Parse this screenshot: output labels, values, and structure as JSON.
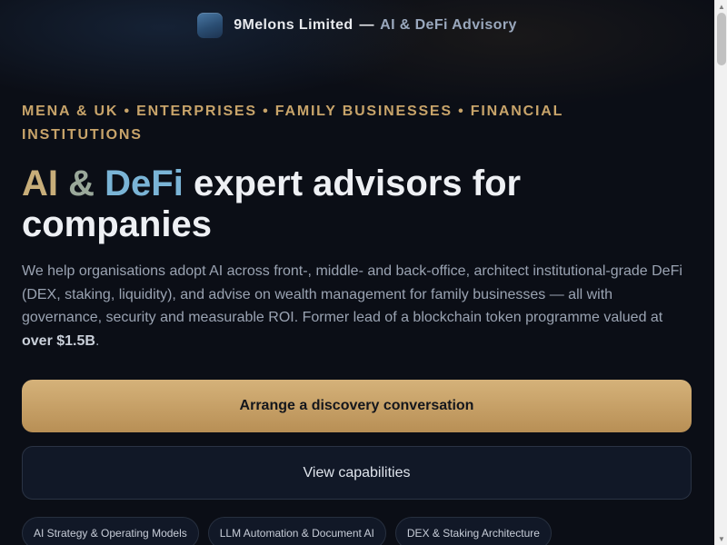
{
  "header": {
    "brand_name": "9Melons Limited",
    "separator": "—",
    "tagline": "AI & DeFi Advisory"
  },
  "hero": {
    "eyebrow": "MENA & UK • ENTERPRISES • FAMILY BUSINESSES • FINANCIAL INSTITUTIONS",
    "headline_ai": "AI",
    "headline_amp": "&",
    "headline_defi": "DeFi",
    "headline_rest": "expert advisors for companies",
    "lead_text": "We help organisations adopt AI across front-, middle- and back-office, architect institutional-grade DeFi (DEX, staking, liquidity), and advise on wealth management for family businesses — all with governance, security and measurable ROI. Former lead of a blockchain token programme valued at",
    "lead_highlight": "over $1.5B",
    "lead_end": "."
  },
  "actions": {
    "primary_label": "Arrange a discovery conversation",
    "secondary_label": "View capabilities"
  },
  "chips": [
    "AI Strategy & Operating Models",
    "LLM Automation & Document AI",
    "DEX & Staking Architecture"
  ],
  "scrollbar": {
    "up_glyph": "▲",
    "down_glyph": "▼"
  },
  "colors": {
    "background": "#0b0e16",
    "accent_gold": "#c8a46a",
    "accent_blue": "#7ab4d6",
    "primary_button": "#c8a266"
  }
}
